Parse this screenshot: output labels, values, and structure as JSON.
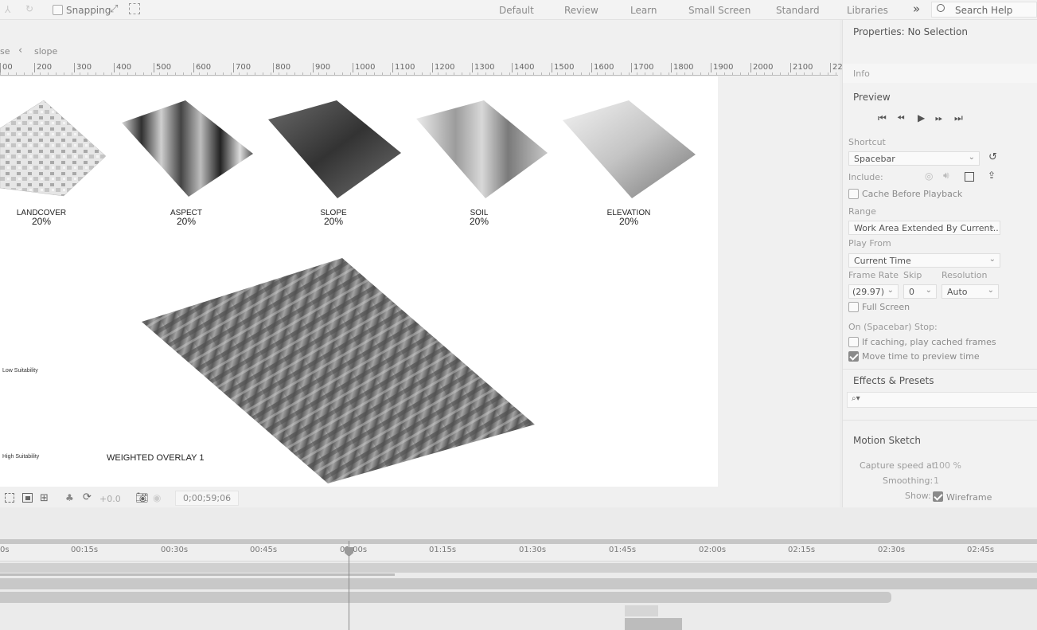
{
  "topbar": {
    "snapping_label": "Snapping",
    "workspaces": [
      "Default",
      "Review",
      "Learn",
      "Small Screen",
      "Standard",
      "Libraries"
    ],
    "more_glyph": "»",
    "search_placeholder": "Search Help"
  },
  "viewer": {
    "breadcrumb_prev": "se",
    "breadcrumb_sep": "‹",
    "breadcrumb_current": "slope",
    "ruler_ticks": [
      "00",
      "200",
      "300",
      "400",
      "500",
      "600",
      "700",
      "800",
      "900",
      "1000",
      "1100",
      "1200",
      "1300",
      "1400",
      "1500",
      "1600",
      "1700",
      "1800",
      "1900",
      "2000",
      "2100",
      "22"
    ],
    "exposure": "+0.0",
    "timecode": "0;00;59;06"
  },
  "composition": {
    "layers": [
      {
        "name": "LANDCOVER",
        "weight": "20%"
      },
      {
        "name": "ASPECT",
        "weight": "20%"
      },
      {
        "name": "SLOPE",
        "weight": "20%"
      },
      {
        "name": "SOIL",
        "weight": "20%"
      },
      {
        "name": "ELEVATION",
        "weight": "20%"
      }
    ],
    "low_label": "Low Suitability",
    "high_label": "High Suitability",
    "overlay_title": "WEIGHTED OVERLAY 1"
  },
  "properties": {
    "title": "Properties: No Selection"
  },
  "info": {
    "title": "Info"
  },
  "preview": {
    "title": "Preview",
    "shortcut_label": "Shortcut",
    "shortcut_value": "Spacebar",
    "include_label": "Include:",
    "cache_label": "Cache Before Playback",
    "range_label": "Range",
    "range_value": "Work Area Extended By Current...",
    "playfrom_label": "Play From",
    "playfrom_value": "Current Time",
    "framerate_label": "Frame Rate",
    "framerate_value": "(29.97)",
    "skip_label": "Skip",
    "skip_value": "0",
    "resolution_label": "Resolution",
    "resolution_value": "Auto",
    "fullscreen_label": "Full Screen",
    "stop_label": "On (Spacebar) Stop:",
    "ifcaching_label": "If caching, play cached frames",
    "movetime_label": "Move time to preview time"
  },
  "effects": {
    "title": "Effects & Presets",
    "search_glyph": "⌕▾"
  },
  "motion_sketch": {
    "title": "Motion Sketch",
    "capture_label": "Capture speed at:",
    "capture_value": "100 %",
    "smoothing_label": "Smoothing:",
    "smoothing_value": "1",
    "show_label": "Show:",
    "wireframe_label": "Wireframe"
  },
  "timeline": {
    "ticks": [
      "0s",
      "00:15s",
      "00:30s",
      "00:45s",
      "01:00s",
      "01:15s",
      "01:30s",
      "01:45s",
      "02:00s",
      "02:15s",
      "02:30s",
      "02:45s"
    ]
  }
}
